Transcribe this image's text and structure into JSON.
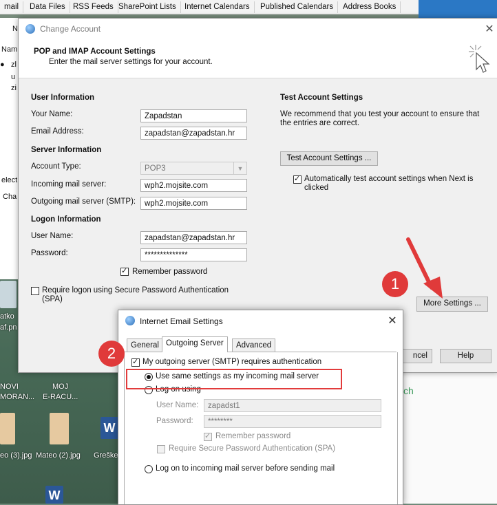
{
  "background": {
    "tabs": [
      "mail",
      "Data Files",
      "RSS Feeds",
      "SharePoint Lists",
      "Internet Calendars",
      "Published Calendars",
      "Address Books"
    ],
    "left_panel": [
      "N",
      "Nam",
      "zl",
      "u",
      "zi",
      "elect",
      "Cha"
    ],
    "desktop_labels": [
      "atko",
      "af.pn",
      "NOVI",
      "MORAN...",
      "MOJ",
      "E-RACU...",
      "eo (3).jpg",
      "Mateo (2).jpg",
      "Greške.",
      "ch"
    ]
  },
  "change_account": {
    "title": "Change Account",
    "heading": "POP and IMAP Account Settings",
    "subheading": "Enter the mail server settings for your account.",
    "user_info": {
      "section": "User Information",
      "your_name_label": "Your Name:",
      "your_name": "Zapadstan",
      "email_label": "Email Address:",
      "email": "zapadstan@zapadstan.hr"
    },
    "server_info": {
      "section": "Server Information",
      "account_type_label": "Account Type:",
      "account_type": "POP3",
      "incoming_label": "Incoming mail server:",
      "incoming": "wph2.mojsite.com",
      "outgoing_label": "Outgoing mail server (SMTP):",
      "outgoing": "wph2.mojsite.com"
    },
    "logon_info": {
      "section": "Logon Information",
      "username_label": "User Name:",
      "username": "zapadstan@zapadstan.hr",
      "password_label": "Password:",
      "password": "**************",
      "remember_password": "Remember password",
      "require_spa": "Require logon using Secure Password Authentication (SPA)"
    },
    "test": {
      "section": "Test Account Settings",
      "description": "We recommend that you test your account to ensure that the entries are correct.",
      "button": "Test Account Settings ...",
      "auto_test": "Automatically test account settings when Next is clicked"
    },
    "more_settings_button": "More Settings ...",
    "cancel_button": "ncel",
    "help_button": "Help"
  },
  "internet_email_settings": {
    "title": "Internet Email Settings",
    "tabs": [
      "General",
      "Outgoing Server",
      "Advanced"
    ],
    "active_tab": "Outgoing Server",
    "smtp_requires_auth": "My outgoing server (SMTP) requires authentication",
    "use_same_settings": "Use same settings as my incoming mail server",
    "log_on_using": "Log on using",
    "username_label": "User Name:",
    "username": "zapadst1",
    "password_label": "Password:",
    "password": "********",
    "remember_password": "Remember password",
    "require_spa": "Require Secure Password Authentication (SPA)",
    "log_on_incoming_first": "Log on to incoming mail server before sending mail"
  },
  "annotations": {
    "badge1": "1",
    "badge2": "2"
  },
  "colors": {
    "annotation_red": "#e03a3a",
    "titlebar_blue": "#2b78c5"
  }
}
